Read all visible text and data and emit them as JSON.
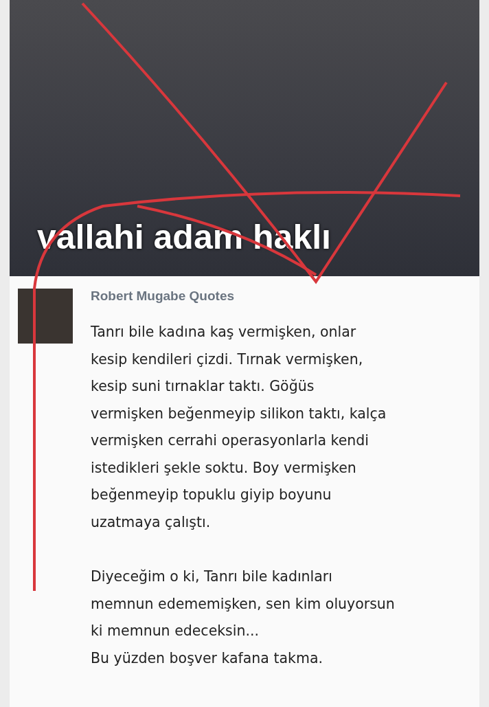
{
  "photo": {
    "caption": "vallahi adam haklı"
  },
  "post": {
    "author": "Robert Mugabe Quotes",
    "paragraphs": [
      {
        "lines": [
          "Tanrı bile kadına kaş vermişken, onlar",
          "kesip kendileri çizdi. Tırnak vermişken,",
          "kesip suni tırnaklar taktı. Göğüs",
          "vermişken beğenmeyip silikon taktı, kalça",
          "vermişken cerrahi operasyonlarla kendi",
          "istedikleri şekle soktu. Boy vermişken",
          "beğenmeyip topuklu giyip boyunu",
          "uzatmaya çalıştı."
        ]
      },
      {
        "lines": [
          "Diyeceğim o ki, Tanrı bile kadınları",
          "memnun edememişken, sen kim oluyorsun",
          "ki memnun edeceksin...",
          "Bu yüzden boşver kafana takma."
        ]
      }
    ]
  }
}
